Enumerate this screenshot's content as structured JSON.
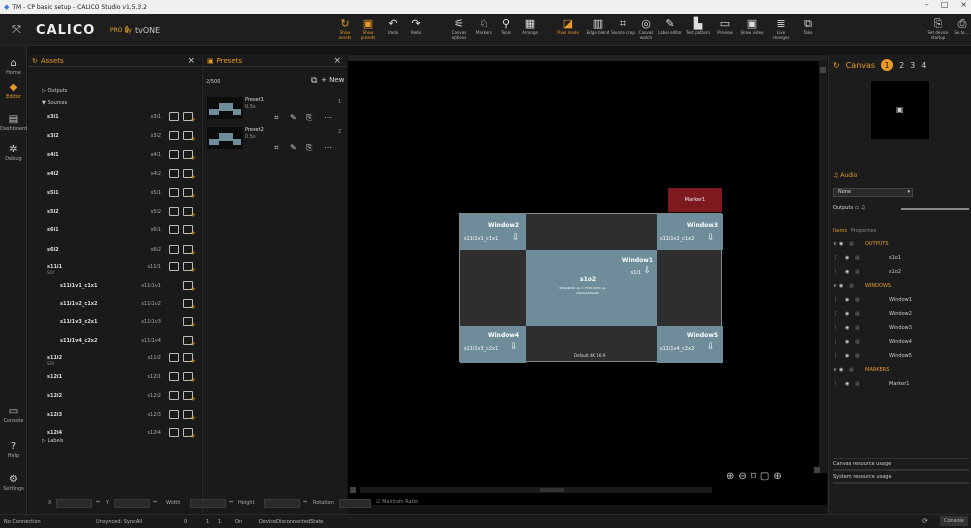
{
  "window": {
    "title": "TM - CP basic setup - CALICO Studio v1.5.3.2",
    "controls": [
      "–",
      "□",
      "×"
    ]
  },
  "brand": {
    "name": "CALICO",
    "sub": "PRO by",
    "vone": "tvONE"
  },
  "toolbar": [
    {
      "label": "Show assets",
      "icon": "↻",
      "orange": true
    },
    {
      "label": "Show presets",
      "icon": "▣",
      "orange": true
    },
    {
      "label": "Undo",
      "icon": "↶"
    },
    {
      "label": "Redo",
      "icon": "↷"
    },
    {
      "label": "Canvas options",
      "icon": "⚟"
    },
    {
      "label": "Markers",
      "icon": "♘"
    },
    {
      "label": "Tools",
      "icon": "⚲"
    },
    {
      "label": "Arrange",
      "icon": "▦"
    },
    {
      "label": "Pixel mode",
      "icon": "◪",
      "orange": true
    },
    {
      "label": "Edge blend",
      "icon": "▥"
    },
    {
      "label": "Source crop",
      "icon": "⌗"
    },
    {
      "label": "Canvas watch",
      "icon": "◎"
    },
    {
      "label": "Label editor",
      "icon": "✎"
    },
    {
      "label": "Test pattern",
      "icon": "▙"
    },
    {
      "label": "Preview",
      "icon": "▭"
    },
    {
      "label": "Show video",
      "icon": "▣"
    },
    {
      "label": "Live changes",
      "icon": "≣"
    },
    {
      "label": "Take",
      "icon": "⧉"
    },
    {
      "label": "Set device startup",
      "icon": "⎘"
    },
    {
      "label": "Se to ...",
      "icon": "⎙"
    }
  ],
  "nav": [
    {
      "label": "Home",
      "icon": "⌂"
    },
    {
      "label": "Editor",
      "icon": "◆",
      "active": true
    },
    {
      "label": "Dashboard",
      "icon": "▤"
    },
    {
      "label": "Debug",
      "icon": "✲"
    },
    {
      "label": "Console",
      "icon": "▭"
    },
    {
      "label": "Help",
      "icon": "?"
    },
    {
      "label": "Settings",
      "icon": "⚙"
    }
  ],
  "assets": {
    "title": "Assets",
    "groups": [
      "Outputs",
      "Sources",
      "Labels"
    ],
    "rows": [
      {
        "name": "s3i1",
        "tag": "s3i1"
      },
      {
        "name": "s3i2",
        "tag": "s3i2"
      },
      {
        "name": "s4i1",
        "tag": "s4i1"
      },
      {
        "name": "s4i2",
        "tag": "s4i2"
      },
      {
        "name": "s5i1",
        "tag": "s5i1"
      },
      {
        "name": "s5i2",
        "tag": "s5i2"
      },
      {
        "name": "s6i1",
        "tag": "s6i1"
      },
      {
        "name": "s6i2",
        "tag": "s6i2"
      },
      {
        "name": "s11i1",
        "sub": "SDI",
        "tag": "s11i1"
      },
      {
        "name": "s11i1v1_c1x1",
        "tag": "s11i1v1",
        "child": true
      },
      {
        "name": "s11i1v2_c1x2",
        "tag": "s11i1v2",
        "child": true
      },
      {
        "name": "s11i1v3_c2x1",
        "tag": "s11i1v3",
        "child": true
      },
      {
        "name": "s11i1v4_c2x2",
        "tag": "s11i1v4",
        "child": true
      },
      {
        "name": "s11i2",
        "sub": "SDI",
        "tag": "s11i2"
      },
      {
        "name": "s12i1",
        "tag": "s12i1"
      },
      {
        "name": "s12i2",
        "tag": "s12i2"
      },
      {
        "name": "s12i3",
        "tag": "s12i3"
      },
      {
        "name": "s12i4",
        "tag": "s12i4"
      }
    ]
  },
  "presets": {
    "title": "Presets",
    "count": "2/500",
    "new_label": "New",
    "items": [
      {
        "name": "Preset1",
        "time": "0.5s",
        "num": "1"
      },
      {
        "name": "Preset2",
        "time": "0.5s",
        "num": "2"
      }
    ]
  },
  "canvas": {
    "marker": "Marker1",
    "default_label": "Default 4K 16:9",
    "windows": [
      {
        "title": "Window2",
        "src": "s11i1v1_c1x1"
      },
      {
        "title": "Window3",
        "src": "s11i1v2_c1x2"
      },
      {
        "title": "Window1",
        "src": "s1i1",
        "center_title": "s1o2",
        "center_sub1": "3840/2000 up = 3700,0000 up",
        "center_sub2": "1920x1080p60"
      },
      {
        "title": "Window4",
        "src": "s11i1v3_c2x1"
      },
      {
        "title": "Window5",
        "src": "s11i1v4_c2x2"
      }
    ]
  },
  "right": {
    "canvas_label": "Canvas",
    "canvas_tabs": [
      "1",
      "2",
      "3",
      "4"
    ],
    "audio_label": "Audio",
    "audio_select": "None",
    "outputs_label": "Outputs",
    "tabs": [
      "Items",
      "Properties"
    ],
    "tree": [
      {
        "label": "OUTPUTS",
        "head": true
      },
      {
        "label": "s1o1"
      },
      {
        "label": "s1o2"
      },
      {
        "label": "WINDOWS",
        "head": true
      },
      {
        "label": "Window1"
      },
      {
        "label": "Window2"
      },
      {
        "label": "Window3"
      },
      {
        "label": "Window4"
      },
      {
        "label": "Window5"
      },
      {
        "label": "MARKERS",
        "head": true
      },
      {
        "label": "Marker1"
      }
    ],
    "canvas_usage": "Canvas resource usage",
    "system_usage": "System resource usage"
  },
  "coords": {
    "x_label": "X",
    "y_label": "Y",
    "w_label": "Width",
    "h_label": "Height",
    "r_label": "Rotation",
    "ratio_label": "Maintain Ratio"
  },
  "status": {
    "connection": "No Connection",
    "sync": "Unsynced: SyncAll",
    "n1": "0",
    "n2": "1",
    "n3": "1",
    "on": "On",
    "state": "DeviceDisconnectedState",
    "console": "Console"
  },
  "colors": {
    "accent": "#e89a25",
    "window_fill": "#6e8c99",
    "marker": "#7d1a1f"
  }
}
